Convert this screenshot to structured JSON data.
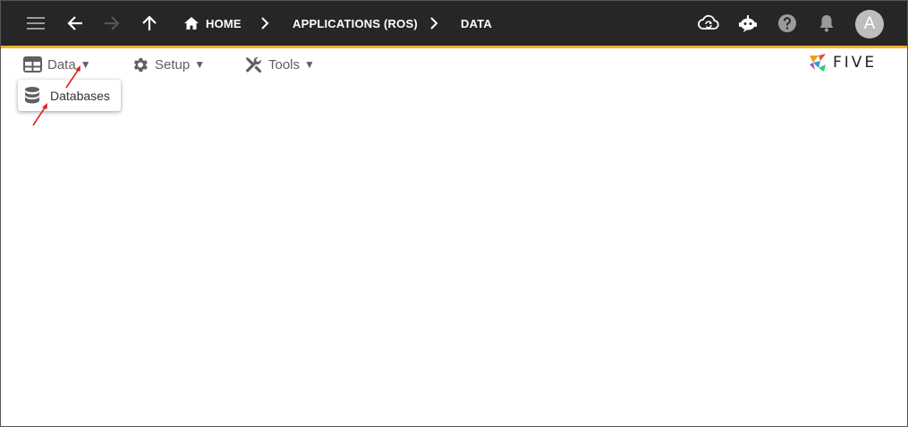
{
  "topbar": {
    "menu_icon": "hamburger-menu-icon",
    "back_icon": "arrow-left-icon",
    "forward_icon": "arrow-right-icon",
    "up_icon": "arrow-up-icon",
    "breadcrumbs": [
      {
        "label": "HOME",
        "icon": "home-icon"
      },
      {
        "label": "APPLICATIONS (ROS)"
      },
      {
        "label": "DATA"
      }
    ],
    "right_icons": [
      "cloud-sync-icon",
      "chatbot-icon",
      "help-icon",
      "notifications-bell-icon"
    ],
    "avatar_initial": "A",
    "accent_color": "#f3b229",
    "background_color": "#262626"
  },
  "menubar": {
    "items": [
      {
        "label": "Data",
        "icon": "table-grid-icon",
        "caret": "▼"
      },
      {
        "label": "Setup",
        "icon": "gear-icon",
        "caret": "▼"
      },
      {
        "label": "Tools",
        "icon": "tools-icon",
        "caret": "▼"
      }
    ]
  },
  "dropdown": {
    "items": [
      {
        "label": "Databases",
        "icon": "database-icon"
      }
    ]
  },
  "logo": {
    "text": "FIVE"
  },
  "annotations": {
    "arrow_color": "#e02020"
  }
}
